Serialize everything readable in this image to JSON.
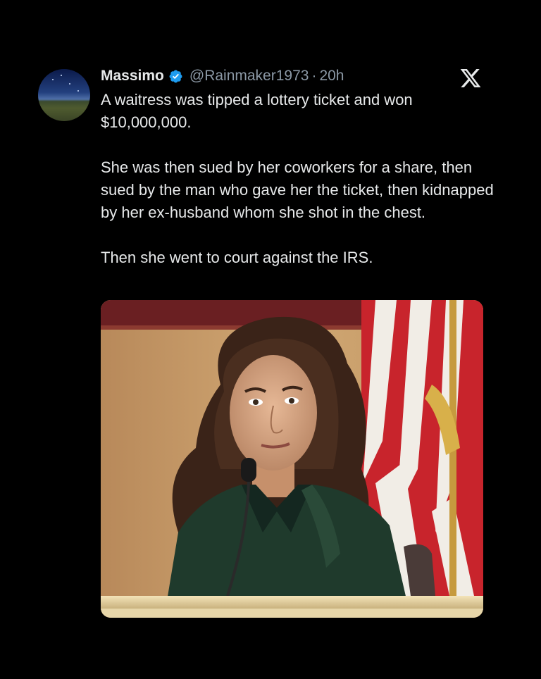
{
  "tweet": {
    "author_name": "Massimo",
    "handle": "@Rainmaker1973",
    "separator": "·",
    "time": "20h",
    "verified_icon": "verified-badge-icon",
    "platform_icon": "x-logo-icon",
    "paragraphs": [
      "A waitress was tipped a lottery ticket and won $10,000,000.",
      "She was then sued by her coworkers for a share, then sued by the man who gave her the ticket, then kidnapped by her ex-husband whom she shot in the chest.",
      "Then she went to court against the IRS."
    ]
  },
  "colors": {
    "background": "#000000",
    "text": "#e7e9ea",
    "secondary_text": "#8b98a5",
    "verified_blue": "#1d9bf0"
  }
}
